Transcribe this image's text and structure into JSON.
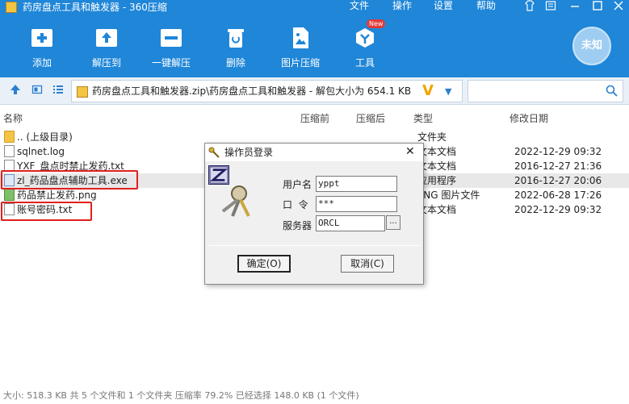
{
  "window": {
    "title": "药房盘点工具和触发器 - 360压缩",
    "menu": [
      "文件",
      "操作",
      "设置",
      "帮助"
    ]
  },
  "toolbar": {
    "items": [
      {
        "label": "添加",
        "icon": "add-archive-icon"
      },
      {
        "label": "解压到",
        "icon": "extract-to-icon"
      },
      {
        "label": "一键解压",
        "icon": "one-click-extract-icon"
      },
      {
        "label": "删除",
        "icon": "delete-icon"
      },
      {
        "label": "图片压缩",
        "icon": "image-compress-icon"
      },
      {
        "label": "工具",
        "icon": "tools-icon"
      }
    ],
    "new_badge": "New",
    "weizhi_label": "未知"
  },
  "address": {
    "path": "药房盘点工具和触发器.zip\\药房盘点工具和触发器 - 解包大小为 654.1 KB",
    "search_placeholder": ""
  },
  "list": {
    "headers": [
      "名称",
      "压缩前",
      "压缩后",
      "类型",
      "修改日期"
    ],
    "rows": [
      {
        "name": ".. (上级目录)",
        "type": "文件夹",
        "date": "",
        "icon": "folder-icon"
      },
      {
        "name": "sqlnet.log",
        "type": "文本文档",
        "date": "2022-12-29 09:32",
        "icon": "text-file-icon"
      },
      {
        "name": "YXF_盘点时禁止发药.txt",
        "type": "文本文档",
        "date": "2016-12-27 21:36",
        "icon": "text-file-icon"
      },
      {
        "name": "zl_药品盘点辅助工具.exe",
        "type": "应用程序",
        "date": "2016-12-27 20:06",
        "icon": "exe-file-icon"
      },
      {
        "name": "药品禁止发药.png",
        "type": "PNG 图片文件",
        "date": "2022-06-28 17:26",
        "icon": "png-file-icon"
      },
      {
        "name": "账号密码.txt",
        "type": "文本文档",
        "date": "2022-12-29 09:32",
        "icon": "text-file-icon"
      }
    ]
  },
  "dialog": {
    "title": "操作员登录",
    "username_label": "用户名",
    "username_value": "yppt",
    "password_label": "口  令",
    "password_value": "***",
    "server_label": "服务器",
    "server_value": "ORCL",
    "browse_label": "...",
    "ok_label": "确定(O)",
    "cancel_label": "取消(C)"
  },
  "status": "大小: 518.3 KB 共 5 个文件和 1 个文件夹 压缩率 79.2% 已经选择 148.0 KB (1 个文件)",
  "colors": {
    "brand": "#1f86d8",
    "highlight": "#e0201c"
  }
}
